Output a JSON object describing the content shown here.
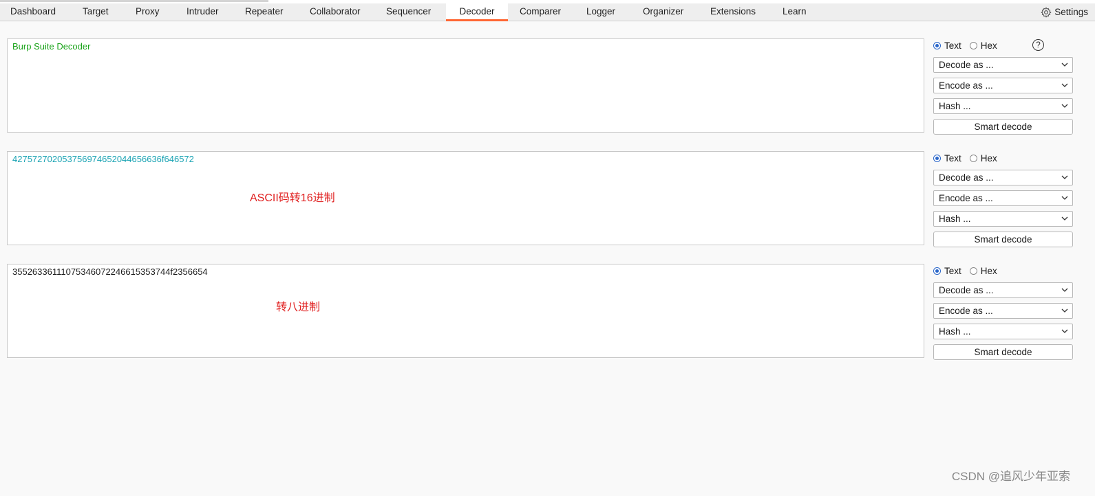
{
  "tabs": [
    {
      "label": "Dashboard"
    },
    {
      "label": "Target"
    },
    {
      "label": "Proxy"
    },
    {
      "label": "Intruder"
    },
    {
      "label": "Repeater"
    },
    {
      "label": "Collaborator"
    },
    {
      "label": "Sequencer"
    },
    {
      "label": "Decoder",
      "active": true
    },
    {
      "label": "Comparer"
    },
    {
      "label": "Logger"
    },
    {
      "label": "Organizer"
    },
    {
      "label": "Extensions"
    },
    {
      "label": "Learn"
    }
  ],
  "settings_label": "Settings",
  "colors": {
    "accent": "#ff6633",
    "panel1_text": "#1aa31a",
    "panel2_text": "#1aa3b3",
    "panel3_text": "#1a1a1a",
    "annotation": "#e02020"
  },
  "panels": [
    {
      "content": "Burp Suite Decoder",
      "annotation": "",
      "mode_text": "Text",
      "mode_hex": "Hex",
      "selected_mode": "Text",
      "decode_label": "Decode as ...",
      "encode_label": "Encode as ...",
      "hash_label": "Hash ...",
      "smart_decode_label": "Smart decode",
      "show_help": true
    },
    {
      "content": "427572702053756974652044656636f646572",
      "annotation": "ASCII码转16进制",
      "mode_text": "Text",
      "mode_hex": "Hex",
      "selected_mode": "Text",
      "decode_label": "Decode as ...",
      "encode_label": "Encode as ...",
      "hash_label": "Hash ...",
      "smart_decode_label": "Smart decode",
      "show_help": false
    },
    {
      "content": "35526336111075346072246615353744f2356654",
      "annotation": "转八进制",
      "mode_text": "Text",
      "mode_hex": "Hex",
      "selected_mode": "Text",
      "decode_label": "Decode as ...",
      "encode_label": "Encode as ...",
      "hash_label": "Hash ...",
      "smart_decode_label": "Smart decode",
      "show_help": false
    }
  ],
  "help_glyph": "?",
  "watermark": "CSDN @追风少年亚索"
}
